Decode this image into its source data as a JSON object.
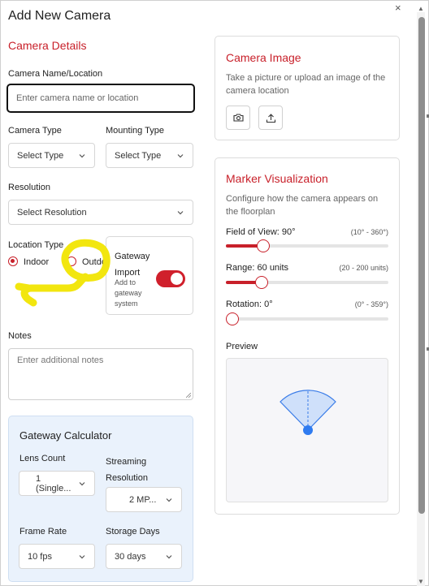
{
  "dialog": {
    "title": "Add New Camera",
    "close_glyph": "×"
  },
  "camera_details": {
    "section_title": "Camera Details",
    "name_label": "Camera Name/Location",
    "name_placeholder": "Enter camera name or location",
    "name_value": "",
    "camera_type_label": "Camera Type",
    "camera_type_value": "Select Type",
    "mounting_type_label": "Mounting Type",
    "mounting_type_value": "Select Type",
    "resolution_label": "Resolution",
    "resolution_value": "Select Resolution",
    "location_type_label": "Location Type",
    "location_options": [
      {
        "label": "Indoor",
        "checked": true
      },
      {
        "label": "Outdoor",
        "checked": false
      }
    ],
    "gateway_import": {
      "title": "Gateway Import",
      "description": "Add to gateway system",
      "enabled": true
    },
    "notes_label": "Notes",
    "notes_placeholder": "Enter additional notes"
  },
  "gateway_calculator": {
    "title": "Gateway Calculator",
    "lens_count_label": "Lens Count",
    "lens_count_value": "1 (Single...",
    "streaming_resolution_label": "Streaming Resolution",
    "streaming_resolution_value": "2 MP...",
    "frame_rate_label": "Frame Rate",
    "frame_rate_value": "10 fps",
    "storage_days_label": "Storage Days",
    "storage_days_value": "30 days"
  },
  "camera_image": {
    "title": "Camera Image",
    "description": "Take a picture or upload an image of the camera location",
    "buttons": [
      {
        "name": "camera-icon"
      },
      {
        "name": "upload-icon"
      }
    ]
  },
  "marker_visualization": {
    "title": "Marker Visualization",
    "description": "Configure how the camera appears on the floorplan",
    "field_of_view": {
      "label": "Field of View: 90°",
      "range": "(10° - 360°)",
      "value": 90,
      "min": 10,
      "max": 360
    },
    "range": {
      "label": "Range: 60 units",
      "range_text": "(20 - 200 units)",
      "value": 60,
      "min": 20,
      "max": 200
    },
    "rotation": {
      "label": "Rotation: 0°",
      "range": "(0° - 359°)",
      "value": 0,
      "min": 0,
      "max": 359
    },
    "preview_label": "Preview"
  },
  "colors": {
    "accent": "#c8202a",
    "calculator_bg": "#eaf2fc",
    "preview_cone": "#cfe0fa",
    "preview_dot": "#2f7bf0",
    "annotation": "#f2e60f"
  }
}
